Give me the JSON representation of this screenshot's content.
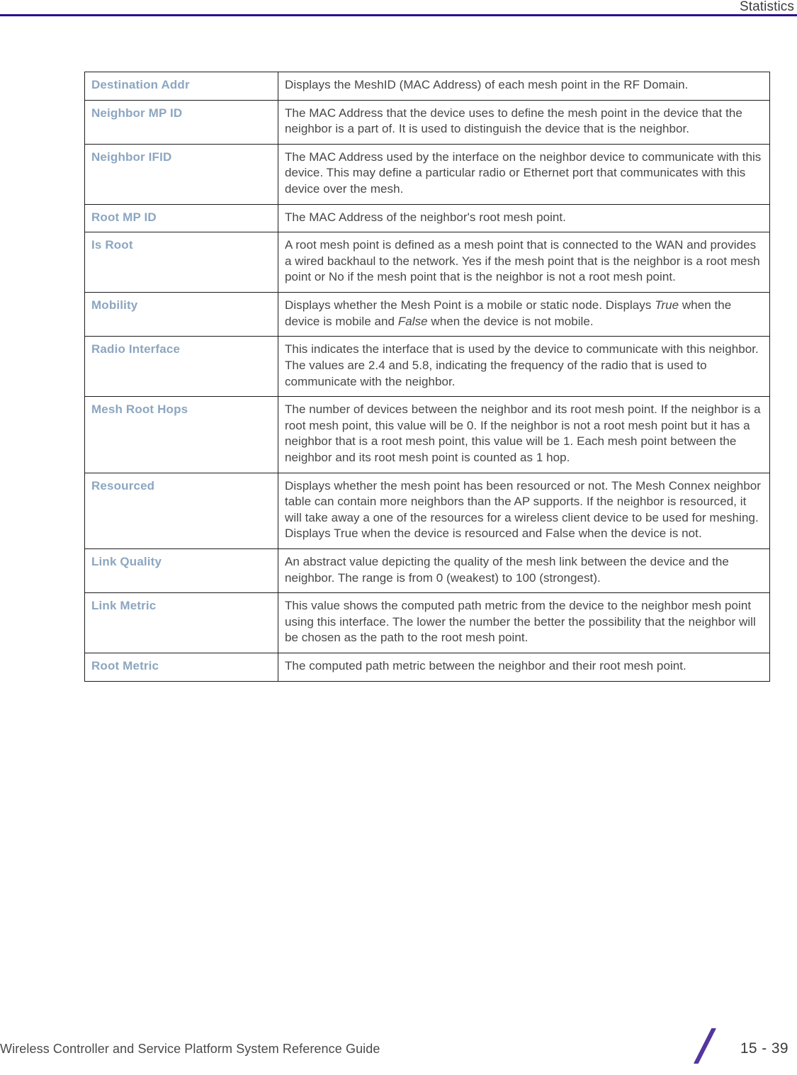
{
  "header": {
    "title": "Statistics",
    "rule_color": "#2d0f8e"
  },
  "table": {
    "term_color": "#8ca6c0",
    "border_color": "#1b1b1b",
    "rows": [
      {
        "term": "Destination Addr",
        "description": "Displays the MeshID (MAC Address) of each mesh point in the RF Domain."
      },
      {
        "term": "Neighbor MP ID",
        "description": "The MAC Address that the device uses to define the mesh point in the device that the neighbor is a part of. It is used to distinguish the device that is the neighbor."
      },
      {
        "term": "Neighbor IFID",
        "description": "The MAC Address used by the interface on the neighbor device to communicate with this device. This may define a particular radio or Ethernet port that communicates with this device over the mesh."
      },
      {
        "term": "Root MP ID",
        "description": "The MAC Address of the neighbor's root mesh point."
      },
      {
        "term": "Is Root",
        "description": "A root mesh point is defined as a mesh point that is connected to the WAN and provides a wired backhaul to the network. Yes if the mesh point that is the neighbor is a root mesh point or No if the mesh point that is the neighbor is not a root mesh point."
      },
      {
        "term": "Mobility",
        "description_parts": [
          {
            "text": "Displays whether the Mesh Point is a mobile or static node. Displays ",
            "italic": false
          },
          {
            "text": "True",
            "italic": true
          },
          {
            "text": " when the device is mobile and ",
            "italic": false
          },
          {
            "text": "False",
            "italic": true
          },
          {
            "text": " when the device is not mobile.",
            "italic": false
          }
        ]
      },
      {
        "term": "Radio Interface",
        "description": "This indicates the interface that is used by the device to communicate with this neighbor. The values are 2.4 and 5.8, indicating the frequency of the radio that is used to communicate with the neighbor."
      },
      {
        "term": "Mesh Root Hops",
        "description": "The number of devices between the neighbor and its root mesh point. If the neighbor is a root mesh point, this value will be 0. If the neighbor is not a root mesh point but it has a neighbor that is a root mesh point, this value will be 1. Each mesh point between the neighbor and its root mesh point is counted as 1 hop."
      },
      {
        "term": "Resourced",
        "description": "Displays whether the mesh point has been resourced or not. The Mesh Connex neighbor table can contain more neighbors than the AP supports. If the neighbor is resourced, it will take away a one of the resources for a wireless client device to be used for meshing. Displays True when the device is resourced and False when the device is not."
      },
      {
        "term": "Link Quality",
        "description": "An abstract value depicting the quality of the mesh link between the device and the neighbor. The range is from 0 (weakest) to 100 (strongest)."
      },
      {
        "term": "Link Metric",
        "description": "This value shows the computed path metric from the device to the neighbor mesh point using this interface. The lower the number the better the possibility that the neighbor will be chosen as the path to the root mesh point."
      },
      {
        "term": "Root Metric",
        "description": "The computed path metric between the neighbor and their root mesh point."
      }
    ]
  },
  "footer": {
    "title": "Wireless Controller and Service Platform System Reference Guide",
    "page_number": "15 - 39",
    "slash_color": "#54359f"
  }
}
